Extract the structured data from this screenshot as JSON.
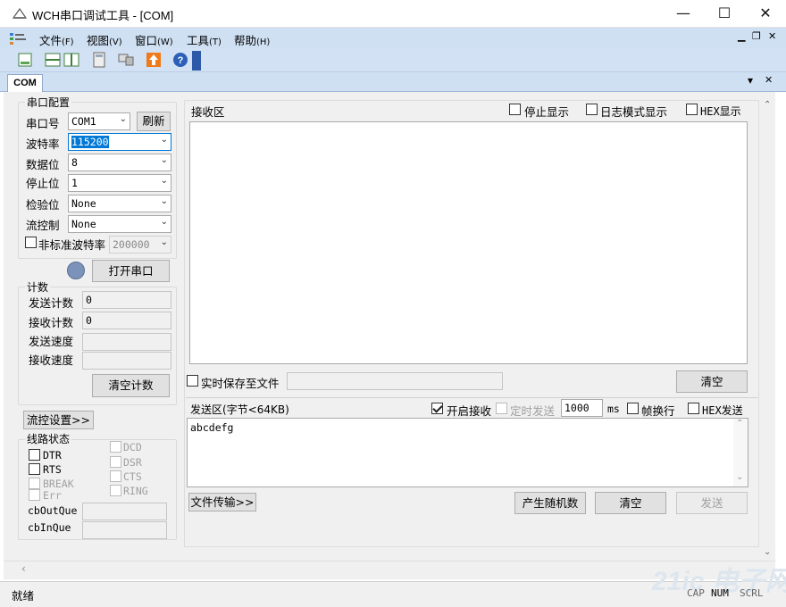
{
  "window": {
    "title": "WCH串口调试工具 - [COM]",
    "min": "—",
    "max": "☐",
    "close": "✕"
  },
  "menu": {
    "items": [
      {
        "label": "文件",
        "key": "(F)"
      },
      {
        "label": "视图",
        "key": "(V)"
      },
      {
        "label": "窗口",
        "key": "(W)"
      },
      {
        "label": "工具",
        "key": "(T)"
      },
      {
        "label": "帮助",
        "key": "(H)"
      }
    ],
    "mdi_min": "▁",
    "mdi_restore": "❐",
    "mdi_close": "✕"
  },
  "tab": {
    "label": "COM",
    "dropdown": "▾",
    "close": "✕"
  },
  "serial": {
    "group": "串口配置",
    "port_label": "串口号",
    "port_value": "COM1",
    "refresh": "刷新",
    "baud_label": "波特率",
    "baud_value": "115200",
    "data_label": "数据位",
    "data_value": "8",
    "stop_label": "停止位",
    "stop_value": "1",
    "parity_label": "检验位",
    "parity_value": "None",
    "flow_label": "流控制",
    "flow_value": "None",
    "nonstd_label": "非标准波特率",
    "nonstd_value": "200000",
    "open": "打开串口"
  },
  "count": {
    "group": "计数",
    "send_count_label": "发送计数",
    "send_count": "0",
    "recv_count_label": "接收计数",
    "recv_count": "0",
    "send_speed_label": "发送速度",
    "send_speed": "",
    "recv_speed_label": "接收速度",
    "recv_speed": "",
    "clear": "清空计数"
  },
  "flow_settings": "流控设置>>",
  "line": {
    "group": "线路状态",
    "dtr": "DTR",
    "rts": "RTS",
    "break": "BREAK",
    "err": "Err",
    "dcd": "DCD",
    "dsr": "DSR",
    "cts": "CTS",
    "ring": "RING",
    "out_label": "cbOutQue",
    "out_value": "",
    "in_label": "cbInQue",
    "in_value": ""
  },
  "receive": {
    "title": "接收区",
    "stop_display": "停止显示",
    "log_mode": "日志模式显示",
    "hex_display": "HEX显示",
    "content": "",
    "save_to_file": "实时保存至文件",
    "file_path": "",
    "clear": "清空"
  },
  "send": {
    "title": "发送区(字节<64KB)",
    "enable_receive": "开启接收",
    "timed_send": "定时发送",
    "interval": "1000",
    "ms": "ms",
    "frame_newline": "帧换行",
    "hex_send": "HEX发送",
    "content": "abcdefg",
    "file_transfer": "文件传输>>",
    "random": "产生随机数",
    "clear": "清空",
    "send": "发送"
  },
  "status": {
    "text": "就绪",
    "cap": "CAP",
    "num": "NUM",
    "scrl": "SCRL",
    "watermark": "21ic 电子网"
  },
  "colors": {
    "menubar": "#cfe0f3",
    "selection": "#0078d7",
    "led": "#7b93ba"
  }
}
